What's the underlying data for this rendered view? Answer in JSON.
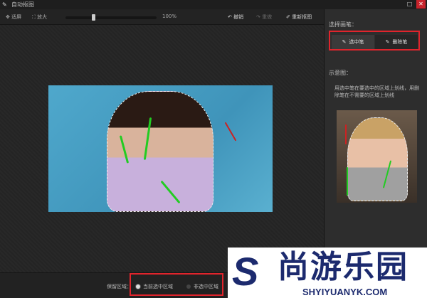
{
  "window": {
    "title": "自动抠图"
  },
  "toolbar": {
    "fit": "适屏",
    "zoom_in": "放大",
    "zoom_level": "100%",
    "zoom_fraction": 0.3,
    "undo": "撤销",
    "redo": "重做",
    "redo_matte": "重新抠图"
  },
  "side": {
    "brush_label": "选择画笔：",
    "select_pen": "选中笔",
    "delete_pen": "删除笔",
    "example_label": "示意图：",
    "description": "用选中笔在要选中的区域上划线，用删除笔在不需要的区域上划线"
  },
  "bottom": {
    "keep_label": "保留区域：",
    "option_selected": "当前选中区域",
    "option_unselected": "非选中区域"
  },
  "watermark": {
    "text_cn": "尚游乐园",
    "text_en": "SHYIYUANYK.COM"
  },
  "colors": {
    "highlight": "#e0242c",
    "stroke_keep": "#22cc22",
    "stroke_remove": "#cc2222"
  }
}
